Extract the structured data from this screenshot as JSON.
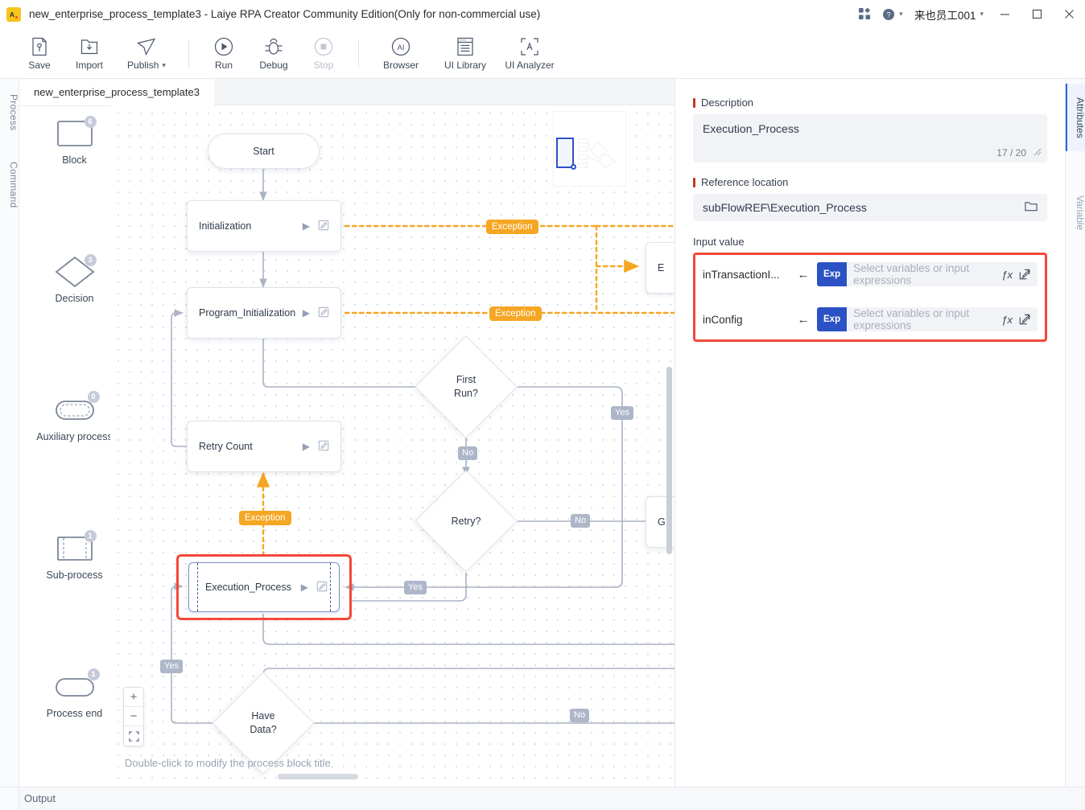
{
  "window": {
    "title": "new_enterprise_process_template3 - Laiye RPA Creator Community Edition(Only for non-commercial use)",
    "logo_text": "AI",
    "user": "来也员工001",
    "grid_icon": "grid-apps-icon",
    "help_icon": "help-circle-icon",
    "minimize": "minimize-icon",
    "maximize": "maximize-icon",
    "close": "close-icon"
  },
  "toolbar": {
    "items": [
      {
        "label": "Save",
        "icon": "save-icon",
        "disabled": false
      },
      {
        "label": "Import",
        "icon": "import-icon",
        "disabled": false
      },
      {
        "label": "Publish",
        "icon": "publish-icon",
        "disabled": false,
        "has_caret": true
      },
      {
        "label": "Run",
        "icon": "run-icon",
        "disabled": false
      },
      {
        "label": "Debug",
        "icon": "debug-icon",
        "disabled": false
      },
      {
        "label": "Stop",
        "icon": "stop-icon",
        "disabled": true
      },
      {
        "label": "Browser",
        "icon": "browser-icon",
        "disabled": false
      },
      {
        "label": "UI Library",
        "icon": "ui-library-icon",
        "disabled": false
      },
      {
        "label": "UI Analyzer",
        "icon": "ui-analyzer-icon",
        "disabled": false
      }
    ]
  },
  "left_strip": {
    "tabs": [
      "Process",
      "Command"
    ]
  },
  "right_strip": {
    "tabs": [
      "Attributes",
      "Variable"
    ],
    "active": "Attributes"
  },
  "tabbar": {
    "open_file": "new_enterprise_process_template3"
  },
  "palette": {
    "items": [
      {
        "label": "Block",
        "count": "6",
        "shape": "rect"
      },
      {
        "label": "Decision",
        "count": "3",
        "shape": "diamond"
      },
      {
        "label": "Auxiliary process",
        "count": "0",
        "shape": "stadium-dashed"
      },
      {
        "label": "Sub-process",
        "count": "1",
        "shape": "rect-dashed"
      },
      {
        "label": "Process end",
        "count": "1",
        "shape": "stadium"
      }
    ]
  },
  "canvas": {
    "hint": "Double-click to modify the process block title",
    "zoom_controls": {
      "zoom_in": "+",
      "zoom_out": "−",
      "fit": "fit-screen-icon"
    },
    "nodes": [
      {
        "id": "start",
        "label": "Start",
        "type": "terminator"
      },
      {
        "id": "initialization",
        "label": "Initialization",
        "type": "block"
      },
      {
        "id": "program_initialization",
        "label": "Program_Initialization",
        "type": "block"
      },
      {
        "id": "retry_count",
        "label": "Retry Count",
        "type": "block"
      },
      {
        "id": "execution_process",
        "label": "Execution_Process",
        "type": "sub-process",
        "selected": true
      },
      {
        "id": "first_run",
        "label": "First\nRun?",
        "type": "decision"
      },
      {
        "id": "retry",
        "label": "Retry?",
        "type": "decision"
      },
      {
        "id": "have_data",
        "label": "Have\nData?",
        "type": "decision"
      },
      {
        "id": "clipped_e",
        "label": "E",
        "type": "block"
      },
      {
        "id": "clipped_g",
        "label": "G",
        "type": "block"
      }
    ],
    "edge_labels": [
      {
        "text": "Exception",
        "kind": "exception"
      },
      {
        "text": "Exception",
        "kind": "exception"
      },
      {
        "text": "Exception",
        "kind": "exception"
      },
      {
        "text": "Yes",
        "kind": "branch"
      },
      {
        "text": "No",
        "kind": "branch"
      },
      {
        "text": "No",
        "kind": "branch"
      },
      {
        "text": "Yes",
        "kind": "branch"
      },
      {
        "text": "Yes",
        "kind": "branch"
      },
      {
        "text": "No",
        "kind": "branch"
      }
    ],
    "labels": {
      "start": "Start",
      "initialization": "Initialization",
      "program_initialization": "Program_Initialization",
      "retry_count": "Retry Count",
      "execution_process": "Execution_Process",
      "first_run_1": "First",
      "first_run_2": "Run?",
      "retry": "Retry?",
      "have_data_1": "Have",
      "have_data_2": "Data?",
      "clipped_e": "E",
      "clipped_g": "G",
      "exception_1": "Exception",
      "exception_2": "Exception",
      "exception_3": "Exception",
      "yes_first_run": "Yes",
      "no_first_run": "No",
      "no_retry": "No",
      "yes_retry": "Yes",
      "yes_exec": "Yes",
      "no_have_data": "No"
    }
  },
  "attributes": {
    "description": {
      "label": "Description",
      "value": "Execution_Process",
      "counter": "17 / 20",
      "required": true
    },
    "reference_location": {
      "label": "Reference location",
      "value": "subFlowREF\\Execution_Process",
      "required": true,
      "browse_icon": "folder-open-icon"
    },
    "input_value": {
      "label": "Input value",
      "rows": [
        {
          "name": "inTransactionI...",
          "arrow": "←",
          "badge": "Exp",
          "placeholder": "Select variables or input expressions",
          "fx_icon": "fx-icon",
          "edit_icon": "edit-square-icon"
        },
        {
          "name": "inConfig",
          "arrow": "←",
          "badge": "Exp",
          "placeholder": "Select variables or input expressions",
          "fx_icon": "fx-icon",
          "edit_icon": "edit-square-icon"
        }
      ]
    }
  },
  "output": {
    "label": "Output"
  },
  "colors": {
    "accent_blue": "#2b52c4",
    "selection_red": "#f4483a",
    "exception_orange": "#f5a623",
    "edge_gray": "#aeb6c9",
    "required_red": "#c0392b"
  }
}
